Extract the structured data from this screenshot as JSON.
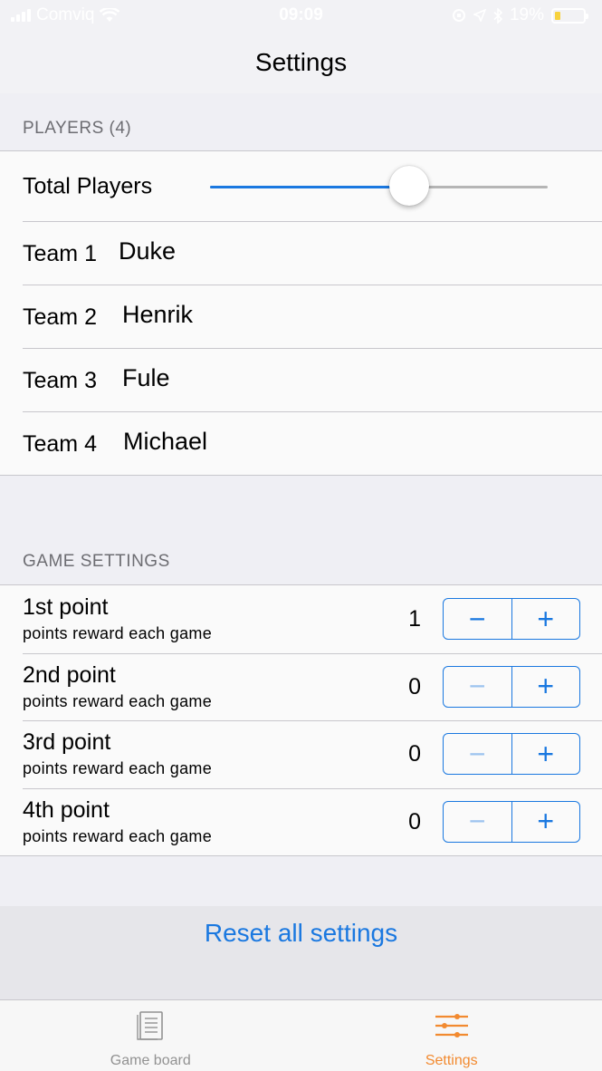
{
  "status_bar": {
    "carrier": "Comviq",
    "time": "09:09",
    "battery_percent": "19%"
  },
  "nav": {
    "title": "Settings"
  },
  "players_section": {
    "header": "PLAYERS (4)",
    "total_players_label": "Total Players",
    "slider_fraction": 0.59,
    "teams": [
      {
        "label": "Team 1",
        "name": "Duke"
      },
      {
        "label": "Team 2",
        "name": "Henrik"
      },
      {
        "label": "Team 3",
        "name": "Fule"
      },
      {
        "label": "Team 4",
        "name": "Michael"
      }
    ]
  },
  "game_section": {
    "header": "GAME SETTINGS",
    "rows": [
      {
        "title": "1st point",
        "subtitle": "points reward each game",
        "value": "1",
        "minus": "−",
        "plus": "+"
      },
      {
        "title": "2nd point",
        "subtitle": "points reward each game",
        "value": "0",
        "minus": "−",
        "plus": "+"
      },
      {
        "title": "3rd point",
        "subtitle": "points reward each game",
        "value": "0",
        "minus": "−",
        "plus": "+"
      },
      {
        "title": "4th point",
        "subtitle": "points reward each game",
        "value": "0",
        "minus": "−",
        "plus": "+"
      }
    ]
  },
  "reset_label": "Reset all settings",
  "tabs": [
    {
      "label": "Game board",
      "icon": "document-icon",
      "active": false
    },
    {
      "label": "Settings",
      "icon": "sliders-icon",
      "active": true
    }
  ],
  "colors": {
    "accent": "#1a78e0",
    "tab_active": "#f28a30",
    "tab_inactive": "#929292"
  }
}
